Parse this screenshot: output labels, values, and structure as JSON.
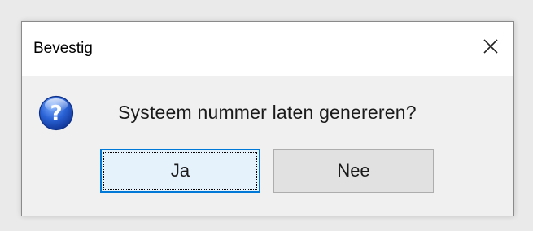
{
  "dialog": {
    "title": "Bevestig",
    "message": "Systeem nummer laten genereren?",
    "icon": "question-icon",
    "close_icon": "close-icon"
  },
  "buttons": {
    "yes_label": "Ja",
    "no_label": "Nee"
  },
  "colors": {
    "titlebar_bg": "#ffffff",
    "body_bg": "#f0f0f0",
    "focused_button_border": "#0078d7",
    "focused_button_bg": "#e5f1fb",
    "button_bg": "#e1e1e1",
    "icon_blue": "#1f55c5"
  }
}
